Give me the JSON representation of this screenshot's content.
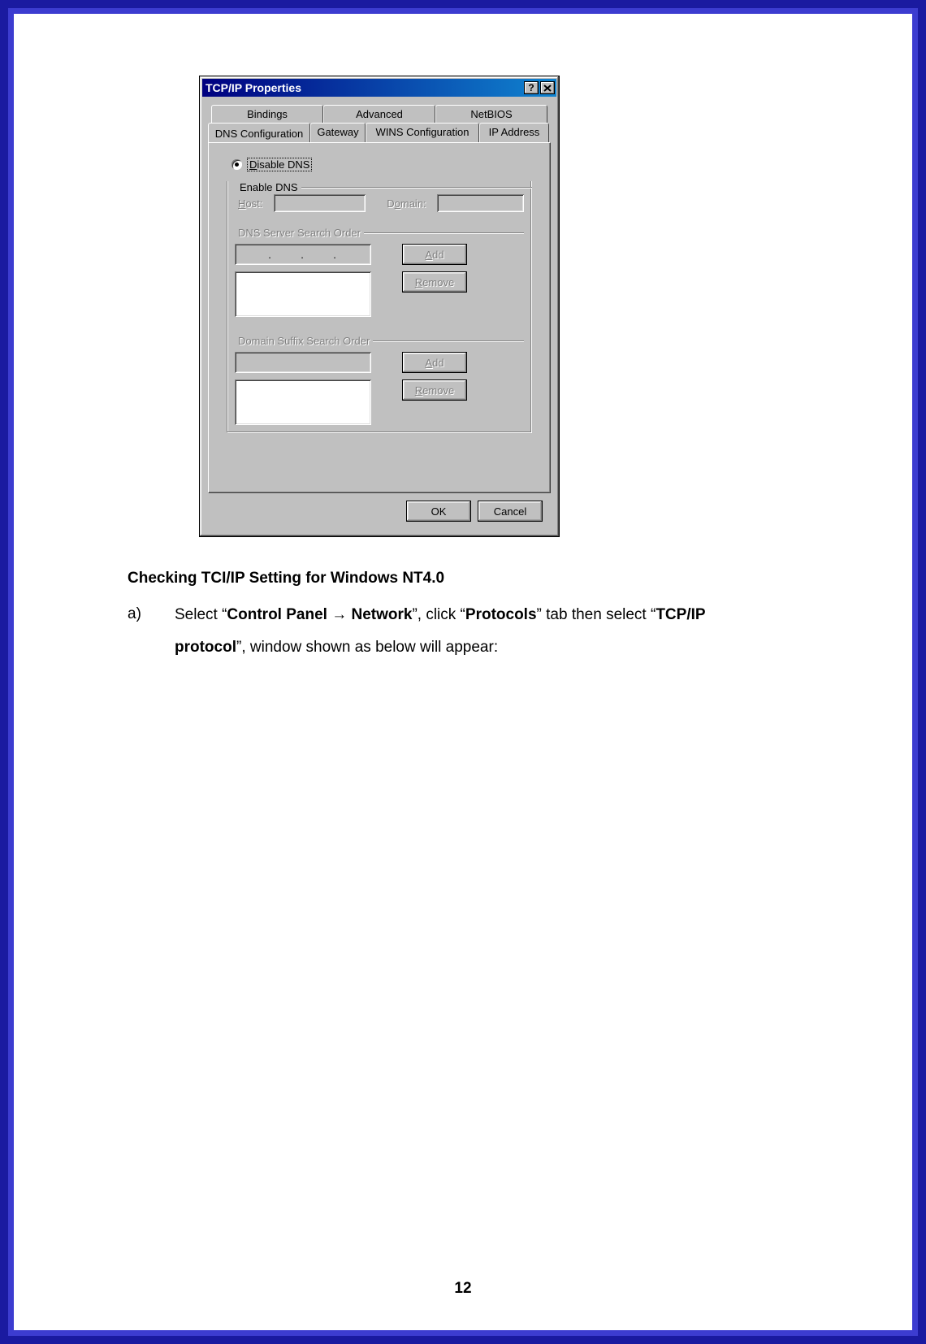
{
  "dialog": {
    "title": "TCP/IP Properties",
    "tabs_row1": [
      "Bindings",
      "Advanced",
      "NetBIOS"
    ],
    "tabs_row2": [
      "DNS Configuration",
      "Gateway",
      "WINS Configuration",
      "IP Address"
    ],
    "active_tab": "DNS Configuration",
    "radio_disable_prefix": "D",
    "radio_disable_rest": "isable DNS",
    "radio_enable_prefix": "E",
    "radio_enable_rest": "nable DNS",
    "host_label_prefix": "H",
    "host_label_rest": "ost:",
    "domain_label_pre": "D",
    "domain_label_u": "o",
    "domain_label_post": "main:",
    "dns_order_legend": "DNS Server Search Order",
    "domain_suffix_legend": "Domain Suffix Search Order",
    "btn_add_u": "A",
    "btn_add_rest": "dd",
    "btn_remove_u": "R",
    "btn_remove_rest": "emove",
    "btn_ok": "OK",
    "btn_cancel": "Cancel"
  },
  "doc": {
    "heading": "Checking TCI/IP Setting for Windows NT4.0",
    "item_marker": "a)",
    "text_1": "Select “",
    "bold_1": "Control Panel → Network",
    "text_2": "”, click “",
    "bold_2": "Protocols",
    "text_3": "” tab then select “",
    "bold_3": "TCP/IP protocol",
    "text_4": "”, window shown as below will appear:",
    "page_number": "12"
  }
}
